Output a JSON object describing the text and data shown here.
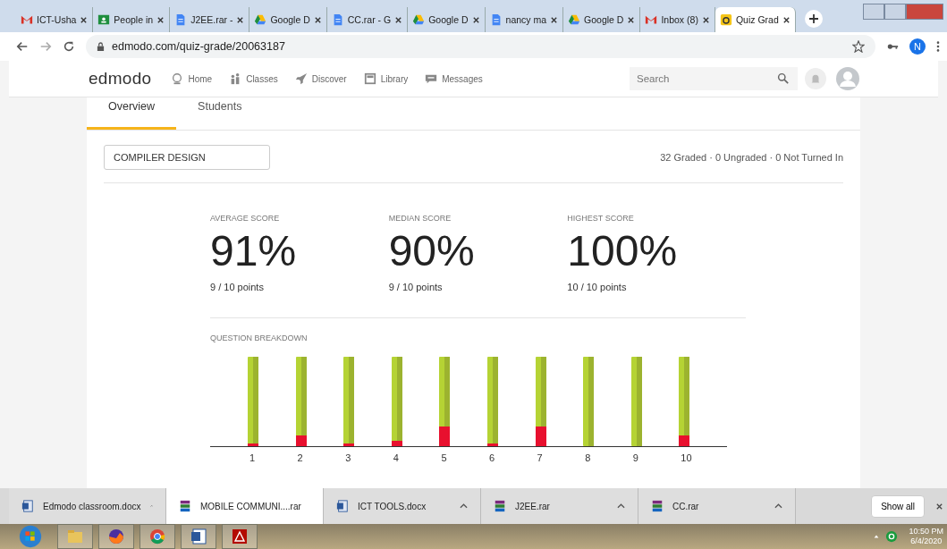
{
  "browser_tabs": [
    {
      "title": "ICT-Usha",
      "kind": "mail",
      "selected": false
    },
    {
      "title": "People in",
      "kind": "classroom",
      "selected": false
    },
    {
      "title": "J2EE.rar -",
      "kind": "doc",
      "selected": false
    },
    {
      "title": "Google D",
      "kind": "drive",
      "selected": false
    },
    {
      "title": "CC.rar - G",
      "kind": "doc",
      "selected": false
    },
    {
      "title": "Google D",
      "kind": "drive",
      "selected": false
    },
    {
      "title": "nancy ma",
      "kind": "doc",
      "selected": false
    },
    {
      "title": "Google D",
      "kind": "drive",
      "selected": false
    },
    {
      "title": "Inbox (8)",
      "kind": "mail",
      "selected": false
    },
    {
      "title": "Quiz Grad",
      "kind": "quiz",
      "selected": true
    }
  ],
  "url": "edmodo.com/quiz-grade/20063187",
  "profile_initial": "N",
  "site": {
    "logo": "edmodo",
    "nav": [
      {
        "label": "Home",
        "kind": "home"
      },
      {
        "label": "Classes",
        "kind": "classes"
      },
      {
        "label": "Discover",
        "kind": "discover"
      },
      {
        "label": "Library",
        "kind": "library"
      },
      {
        "label": "Messages",
        "kind": "messages"
      }
    ],
    "search_placeholder": "Search"
  },
  "page_tabs": [
    {
      "label": "Overview",
      "selected": true
    },
    {
      "label": "Students",
      "selected": false
    }
  ],
  "class_name": "COMPILER DESIGN",
  "summary": "32 Graded · 0 Ungraded · 0 Not Turned In",
  "scores": [
    {
      "label": "AVERAGE SCORE",
      "value": "91%",
      "points": "9 / 10 points"
    },
    {
      "label": "MEDIAN SCORE",
      "value": "90%",
      "points": "9 / 10 points"
    },
    {
      "label": "HIGHEST SCORE",
      "value": "100%",
      "points": "10 / 10 points"
    }
  ],
  "breakdown": {
    "title": "QUESTION BREAKDOWN",
    "questions": [
      "1",
      "2",
      "3",
      "4",
      "5",
      "6",
      "7",
      "8",
      "9",
      "10"
    ]
  },
  "downloads": [
    {
      "name": "Edmodo classroom.docx",
      "kind": "docx"
    },
    {
      "name": "MOBILE COMMUNI....rar",
      "kind": "rar"
    },
    {
      "name": "ICT TOOLS.docx",
      "kind": "docx"
    },
    {
      "name": "J2EE.rar",
      "kind": "rar"
    },
    {
      "name": "CC.rar",
      "kind": "rar"
    }
  ],
  "show_all": "Show all",
  "clock": {
    "time": "10:50 PM",
    "date": "6/4/2020"
  }
}
